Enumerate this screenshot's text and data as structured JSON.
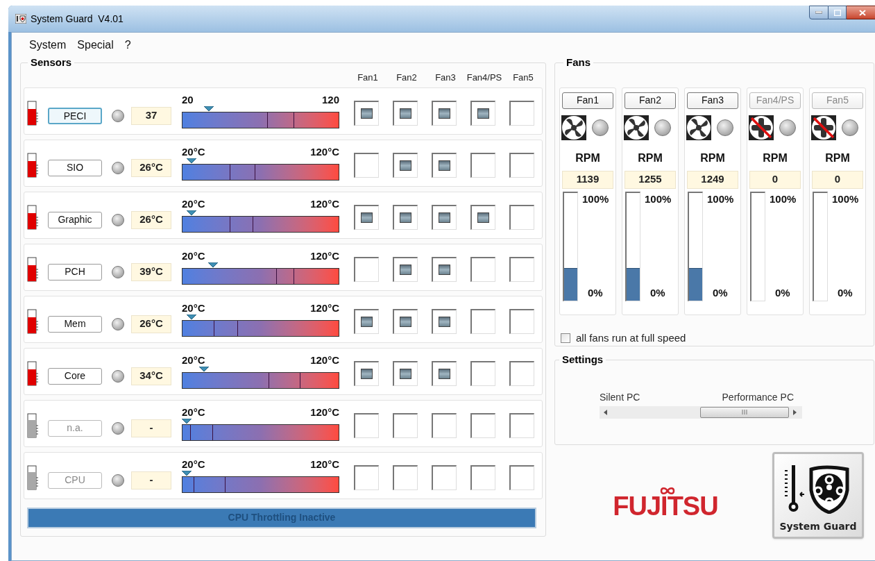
{
  "window": {
    "title": "System Guard  V4.01"
  },
  "menu": [
    "System",
    "Special",
    "?"
  ],
  "sensors": {
    "title": "Sensors",
    "fan_columns": [
      "Fan1",
      "Fan2",
      "Fan3",
      "Fan4/PS",
      "Fan5"
    ],
    "rows": [
      {
        "name": "PECI",
        "disabled": false,
        "focused": true,
        "value": "37",
        "min": "20",
        "max": "120",
        "level": 0.17,
        "thresholds": [
          {
            "level": 0.54
          },
          {
            "level": 0.71
          }
        ],
        "fans": [
          {
            "checked": true
          },
          {
            "checked": true
          },
          {
            "checked": true
          },
          {
            "checked": true
          },
          {
            "checked": false
          }
        ]
      },
      {
        "name": "SIO",
        "disabled": false,
        "focused": false,
        "value": "26°C",
        "min": "20°C",
        "max": "120°C",
        "level": 0.06,
        "thresholds": [
          {
            "level": 0.3
          },
          {
            "level": 0.46
          }
        ],
        "fans": [
          {
            "checked": false
          },
          {
            "checked": true
          },
          {
            "checked": true
          },
          {
            "checked": false
          },
          {
            "checked": false
          }
        ]
      },
      {
        "name": "Graphic",
        "disabled": false,
        "focused": false,
        "value": "26°C",
        "min": "20°C",
        "max": "120°C",
        "level": 0.06,
        "thresholds": [
          {
            "level": 0.3
          },
          {
            "level": 0.45
          }
        ],
        "fans": [
          {
            "checked": true
          },
          {
            "checked": true
          },
          {
            "checked": true
          },
          {
            "checked": true
          },
          {
            "checked": false
          }
        ]
      },
      {
        "name": "PCH",
        "disabled": false,
        "focused": false,
        "value": "39°C",
        "min": "20°C",
        "max": "120°C",
        "level": 0.2,
        "thresholds": [
          {
            "level": 0.6
          },
          {
            "level": 0.71
          }
        ],
        "fans": [
          {
            "checked": false
          },
          {
            "checked": true
          },
          {
            "checked": true
          },
          {
            "checked": false
          },
          {
            "checked": false
          }
        ]
      },
      {
        "name": "Mem",
        "disabled": false,
        "focused": false,
        "value": "26°C",
        "min": "20°C",
        "max": "120°C",
        "level": 0.06,
        "thresholds": [
          {
            "level": 0.2
          },
          {
            "level": 0.35
          }
        ],
        "fans": [
          {
            "checked": true
          },
          {
            "checked": true
          },
          {
            "checked": true
          },
          {
            "checked": false
          },
          {
            "checked": false
          }
        ]
      },
      {
        "name": "Core",
        "disabled": false,
        "focused": false,
        "value": "34°C",
        "min": "20°C",
        "max": "120°C",
        "level": 0.14,
        "thresholds": [
          {
            "level": 0.55
          },
          {
            "level": 0.75
          }
        ],
        "fans": [
          {
            "checked": true
          },
          {
            "checked": true
          },
          {
            "checked": true
          },
          {
            "checked": false
          },
          {
            "checked": false
          }
        ]
      },
      {
        "name": "n.a.",
        "disabled": true,
        "focused": false,
        "value": "-",
        "min": "20°C",
        "max": "120°C",
        "thresholds": [
          {
            "level": 0.05
          },
          {
            "level": 0.19
          }
        ],
        "fans": [
          {
            "checked": false
          },
          {
            "checked": false
          },
          {
            "checked": false
          },
          {
            "checked": false
          },
          {
            "checked": false
          }
        ]
      },
      {
        "name": "CPU",
        "disabled": true,
        "focused": false,
        "value": "-",
        "min": "20°C",
        "max": "120°C",
        "thresholds": [
          {
            "level": 0.07
          },
          {
            "level": 0.27
          }
        ],
        "fans": [
          {
            "checked": false
          },
          {
            "checked": false
          },
          {
            "checked": false
          },
          {
            "checked": false
          },
          {
            "checked": false
          }
        ]
      }
    ],
    "throttling": "CPU Throttling Inactive"
  },
  "fans": {
    "title": "Fans",
    "items": [
      {
        "name": "Fan1",
        "disabled": false,
        "running": true,
        "unit": "RPM",
        "rpm": "1139",
        "max": "100%",
        "min": "0%",
        "level": 0.3
      },
      {
        "name": "Fan2",
        "disabled": false,
        "running": true,
        "unit": "RPM",
        "rpm": "1255",
        "max": "100%",
        "min": "0%",
        "level": 0.3
      },
      {
        "name": "Fan3",
        "disabled": false,
        "running": true,
        "unit": "RPM",
        "rpm": "1249",
        "max": "100%",
        "min": "0%",
        "level": 0.3
      },
      {
        "name": "Fan4/PS",
        "disabled": true,
        "running": false,
        "unit": "RPM",
        "rpm": "0",
        "max": "100%",
        "min": "0%"
      },
      {
        "name": "Fan5",
        "disabled": true,
        "running": false,
        "unit": "RPM",
        "rpm": "0",
        "max": "100%",
        "min": "0%"
      }
    ],
    "full_speed": {
      "label": "all fans run at full speed",
      "checked": false
    }
  },
  "settings": {
    "title": "Settings",
    "left_label": "Silent PC",
    "right_label": "Performance PC"
  },
  "logo": "FUJITSU",
  "app_button": "System Guard"
}
